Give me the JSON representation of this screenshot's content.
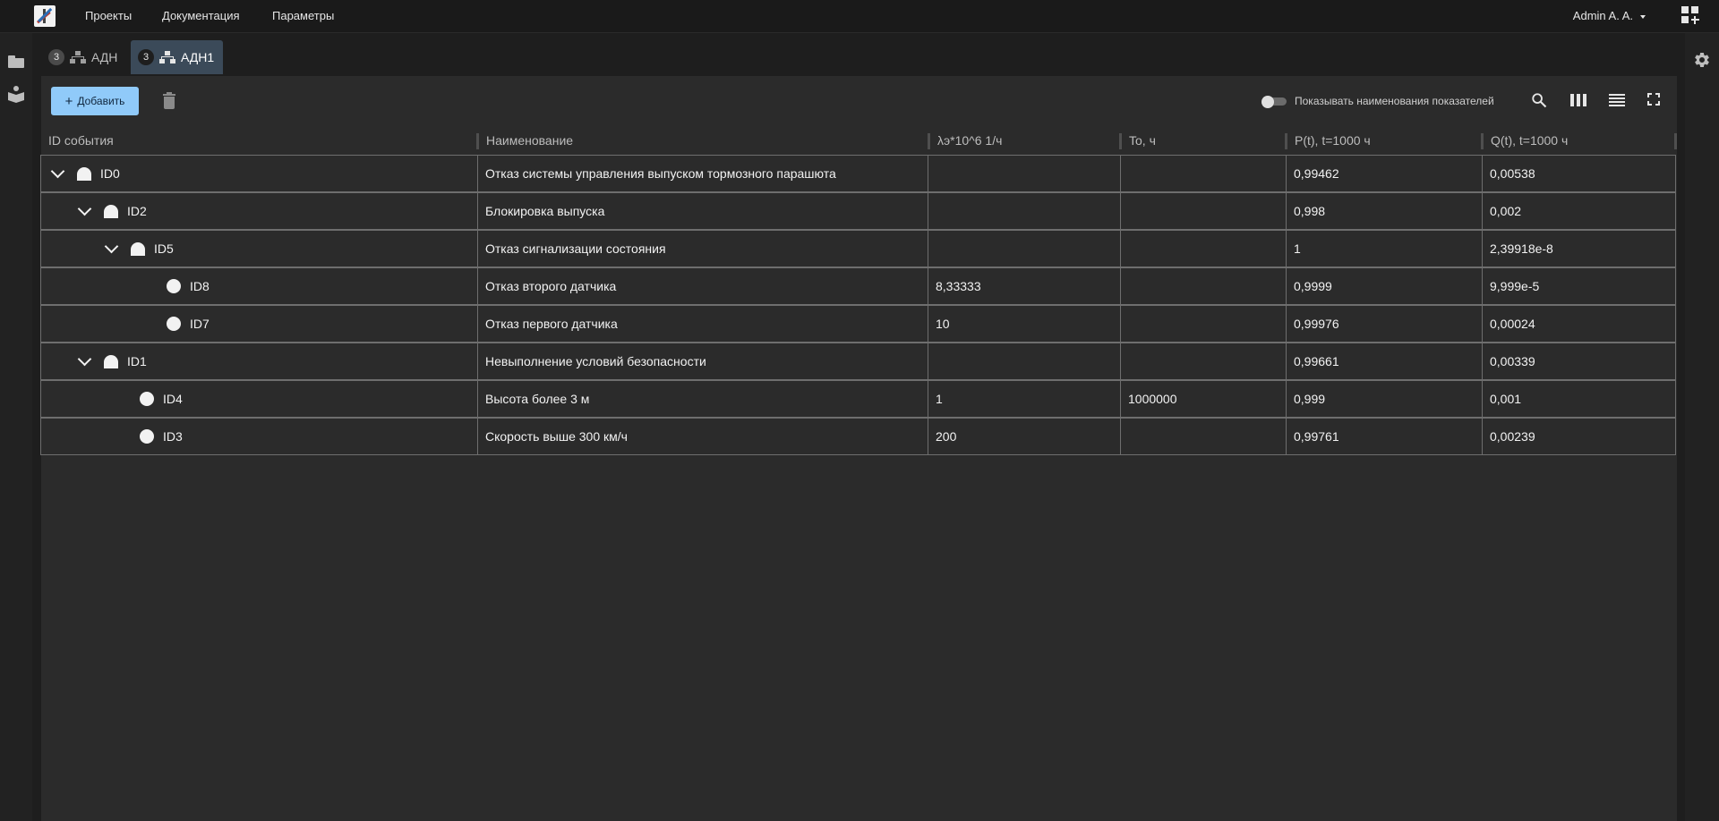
{
  "nav": {
    "items": [
      "Проекты",
      "Документация",
      "Параметры"
    ],
    "user": "Admin A. A."
  },
  "tabs": [
    {
      "badge": "3",
      "label": "АДН"
    },
    {
      "badge": "3",
      "label": "АДН1"
    }
  ],
  "toolbar": {
    "add_label": "Добавить",
    "toggle_label": "Показывать наименования показателей"
  },
  "table": {
    "columns": [
      "ID события",
      "Наименование",
      "λэ*10^6 1/ч",
      "To, ч",
      "P(t), t=1000 ч",
      "Q(t), t=1000 ч"
    ],
    "rows": [
      {
        "id": "ID0",
        "kind": "gate",
        "expanded": true,
        "name": "Отказ системы управления выпуском тормозного парашюта",
        "lambda": "",
        "to": "",
        "p": "0,99462",
        "q": "0,00538"
      },
      {
        "id": "ID2",
        "kind": "gate",
        "expanded": true,
        "name": "Блокировка выпуска",
        "lambda": "",
        "to": "",
        "p": "0,998",
        "q": "0,002"
      },
      {
        "id": "ID5",
        "kind": "gate",
        "expanded": true,
        "name": "Отказ сигнализации состояния",
        "lambda": "",
        "to": "",
        "p": "1",
        "q": "2,39918e-8"
      },
      {
        "id": "ID8",
        "kind": "event",
        "expanded": false,
        "name": "Отказ второго датчика",
        "lambda": "8,33333",
        "to": "",
        "p": "0,9999",
        "q": "9,999e-5"
      },
      {
        "id": "ID7",
        "kind": "event",
        "expanded": false,
        "name": "Отказ первого датчика",
        "lambda": "10",
        "to": "",
        "p": "0,99976",
        "q": "0,00024"
      },
      {
        "id": "ID1",
        "kind": "gate",
        "expanded": true,
        "name": "Невыполнение условий безопасности",
        "lambda": "",
        "to": "",
        "p": "0,99661",
        "q": "0,00339"
      },
      {
        "id": "ID4",
        "kind": "event",
        "expanded": false,
        "name": "Высота более 3 м",
        "lambda": "1",
        "to": "1000000",
        "p": "0,999",
        "q": "0,001"
      },
      {
        "id": "ID3",
        "kind": "event",
        "expanded": false,
        "name": "Скорость выше 300 км/ч",
        "lambda": "200",
        "to": "",
        "p": "0,99761",
        "q": "0,00239"
      }
    ]
  }
}
